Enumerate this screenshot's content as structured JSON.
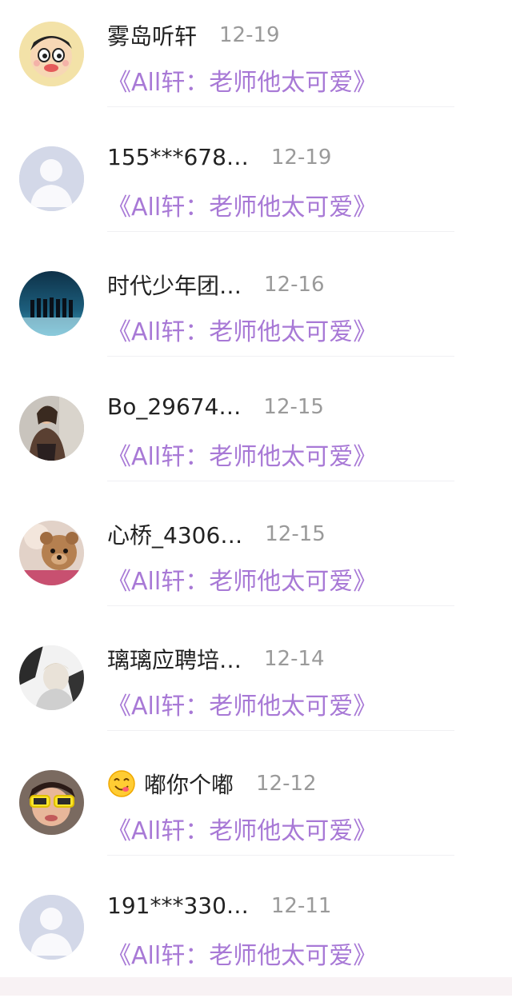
{
  "items": [
    {
      "name": "雾岛听轩",
      "date": "12-19",
      "book": "《All轩：老师他太可爱》",
      "avatar_icon": "cartoon-avatar-icon"
    },
    {
      "name": "155***678…",
      "date": "12-19",
      "book": "《All轩：老师他太可爱》",
      "avatar_icon": "default-avatar-icon"
    },
    {
      "name": "时代少年团…",
      "date": "12-16",
      "book": "《All轩：老师他太可爱》",
      "avatar_icon": "group-photo-avatar-icon"
    },
    {
      "name": "Bo_29674…",
      "date": "12-15",
      "book": "《All轩：老师他太可爱》",
      "avatar_icon": "person-photo-avatar-icon"
    },
    {
      "name": "心桥_4306…",
      "date": "12-15",
      "book": "《All轩：老师他太可爱》",
      "avatar_icon": "teddy-bear-avatar-icon"
    },
    {
      "name": "璃璃应聘培…",
      "date": "12-14",
      "book": "《All轩：老师他太可爱》",
      "avatar_icon": "sketch-avatar-icon"
    },
    {
      "name": "嘟你个嘟",
      "date": "12-12",
      "book": "《All轩：老师他太可爱》",
      "avatar_icon": "sunglasses-avatar-icon",
      "emoji": "yum-emoji-icon"
    },
    {
      "name": "191***330…",
      "date": "12-11",
      "book": "《All轩：老师他太可爱》",
      "avatar_icon": "default-avatar-icon"
    }
  ]
}
